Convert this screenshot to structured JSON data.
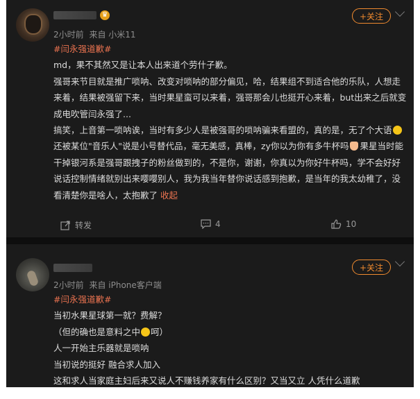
{
  "posts": [
    {
      "time": "2小时前",
      "source": "来自 小米11",
      "follow_label": "+关注",
      "hashtag": "#闫永强道歉#",
      "paragraphs": [
        "md，果不其然又是让本人出来道个劳什子歉。",
        "强哥来节目就是推广唢呐、改变对唢呐的部分偏见，哈，结果组不到适合他的乐队，人想走来着，结果被强留下来，当时果星蛮可以来着，强哥那会儿也挺开心来着，but出来之后就变成电吹管闫永强了...",
        "搞笑，上音第一唢呐诶，当时有多少人是被强哥的唢呐骗来看盟的，真的是，无了个大语",
        "还被某位\"音乐人\"说是小号替代品，毫无美感，真棒，zy你以为你有多牛杯吗",
        "果星当时能干掉银河系是强哥跟拽子的粉丝做到的，不是你，谢谢，你真以为你好牛杯吗，学不会好好说话控制情绪就别出来嘤嘤别人，我为我当年替你说话感到抱歉，是当年的我太幼稚了，没看清楚你是啥人，太抱歉了"
      ],
      "collapse_label": "收起",
      "actions": {
        "repost": "转发",
        "comments": "4",
        "likes": "10"
      }
    },
    {
      "time": "2小时前",
      "source": "来自 iPhone客户端",
      "follow_label": "+关注",
      "hashtag": "#闫永强道歉#",
      "lines": [
        "当初水果星球第一就？费解？",
        "（但的确也是意料之中",
        "呵）",
        "人一开始主乐器就是唢呐",
        "当初说的挺好 融合求人加入",
        "这和求人当家庭主妇后来又说人不赚钱养家有什么区别？又当又立 人凭什么道歉"
      ]
    }
  ],
  "colors": {
    "accent": "#eb7350",
    "follow": "#f18b2f",
    "background": "#1b1b1b"
  }
}
